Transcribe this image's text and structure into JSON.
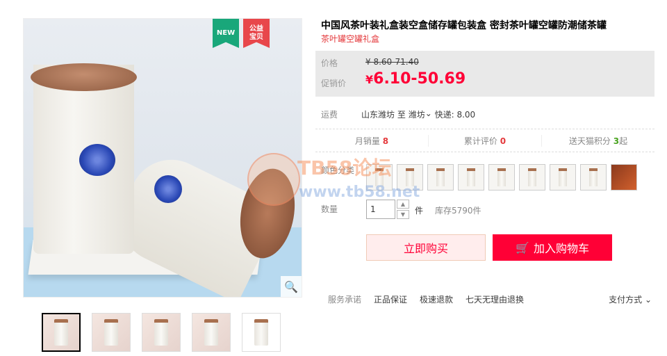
{
  "product": {
    "title": "中国风茶叶装礼盒装空盒储存罐包装盒 密封茶叶罐空罐防潮储茶罐",
    "subtitle": "茶叶罐空罐礼盒",
    "badges": {
      "new": "NEW",
      "charity": "公益\n宝贝"
    }
  },
  "price": {
    "label_price": "价格",
    "original": "¥ 8.60-71.40",
    "label_promo": "促销价",
    "promo_currency": "¥",
    "promo_value": "6.10-50.69"
  },
  "shipping": {
    "label": "运费",
    "from": "山东潍坊",
    "to_word": "至",
    "dest": "潍坊",
    "method": "快递: 8.00"
  },
  "stats": {
    "monthly_sales_label": "月销量",
    "monthly_sales": "8",
    "reviews_label": "累计评价",
    "reviews": "0",
    "points_label": "送天猫积分",
    "points": "3",
    "points_suffix": "起"
  },
  "options": {
    "color_label": "颜色分类",
    "swatch_count": 9
  },
  "quantity": {
    "label": "数量",
    "value": "1",
    "unit": "件",
    "stock": "库存5790件"
  },
  "buttons": {
    "buy_now": "立即购买",
    "add_to_cart": "加入购物车"
  },
  "service": {
    "label": "服务承诺",
    "items": [
      "正品保证",
      "极速退款",
      "七天无理由退换"
    ],
    "payment": "支付方式"
  },
  "watermark": {
    "text": "TB58论坛",
    "url": "www.tb58.net"
  },
  "colors": {
    "accent": "#ff0036",
    "accent_light": "#ffeded",
    "price_bg": "#e9e9e9",
    "link_red": "#e4393c"
  },
  "icons": {
    "zoom": "magnifier-icon",
    "cart": "cart-icon",
    "chevron": "chevron-down-icon"
  }
}
